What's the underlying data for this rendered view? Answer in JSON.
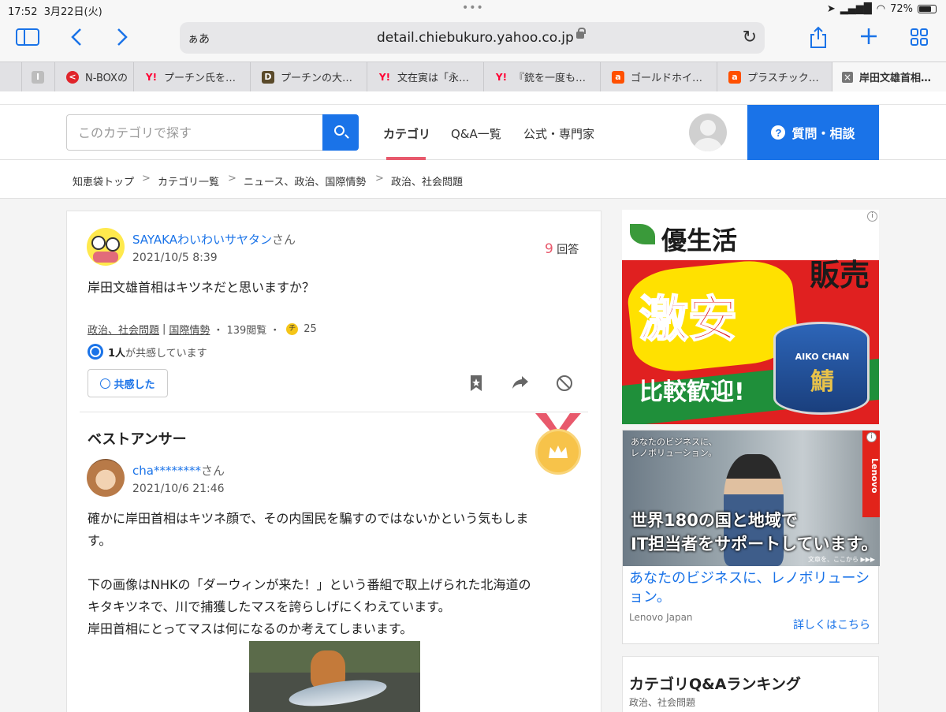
{
  "status_bar": {
    "time": "17:52",
    "date": "3月22日(火)",
    "battery": "72%"
  },
  "browser": {
    "aa_label": "ぁあ",
    "url": "detail.chiebukuro.yahoo.co.jp",
    "tabs": [
      {
        "label": "",
        "favicon": "I",
        "color": "#bdbdbd"
      },
      {
        "label": "N-BOXの",
        "favicon": "<",
        "color": "#e0242b"
      },
      {
        "label": "プーチン氏を…",
        "favicon": "Y!",
        "color": "#ff0033"
      },
      {
        "label": "プーチンの大…",
        "favicon": "D",
        "color": "#5a4a2a"
      },
      {
        "label": "文在寅は「永…",
        "favicon": "Y!",
        "color": "#ff0033"
      },
      {
        "label": "『銃を一度も…",
        "favicon": "Y!",
        "color": "#ff0033"
      },
      {
        "label": "ゴールドホイ…",
        "favicon": "a",
        "color": "#ff5000"
      },
      {
        "label": "プラスチック…",
        "favicon": "a",
        "color": "#ff5000"
      },
      {
        "label": "岸田文雄首相…",
        "favicon": "×",
        "color": "#777777"
      }
    ]
  },
  "header": {
    "search_placeholder": "このカテゴリで探す",
    "nav": [
      "カテゴリ",
      "Q&A一覧",
      "公式・専門家"
    ],
    "ask_button": "質問・相談",
    "accent": "#1a73e8",
    "underline_color": "#e8596c"
  },
  "breadcrumb": [
    "知恵袋トップ",
    "カテゴリ一覧",
    "ニュース、政治、国際情勢",
    "政治、社会問題"
  ],
  "question": {
    "user": "SAYAKAわいわいサヤタン",
    "user_suffix": "さん",
    "date": "2021/10/5 8:39",
    "answer_count": "9",
    "answer_count_suffix": "回答",
    "text": "岸田文雄首相はキツネだと思いますか？",
    "category1": "政治、社会問題",
    "category2": "国際情勢",
    "views": "139閲覧",
    "coin_label": "チ",
    "coins": "25",
    "empathy_count": "1人",
    "empathy_text": "が共感しています",
    "empathy_button": "共感した"
  },
  "best_answer": {
    "heading": "ベストアンサー",
    "user": "cha********",
    "user_suffix": "さん",
    "date": "2021/10/6 21:46",
    "p1a": "確かに岸田首相はキツネ顔で、その内国民を騙すのではないかという気もしま",
    "p1b": "す。",
    "p2a": "下の画像はNHKの「ダーウィンが来た！」という番組で取上げられた北海道の",
    "p2b": "キタキツネで、川で捕獲したマスを誇らしげにくわえています。",
    "p2c": "岸田首相にとってマスは何になるのか考えてしまいます。"
  },
  "ads": {
    "ad1": {
      "brand": "優生活",
      "big": "激安",
      "hanbai": "販売",
      "welcome": "比較歓迎!",
      "can_label": "AIKO CHAN",
      "fish": "鯖"
    },
    "ad2": {
      "small1": "あなたのビジネスに、",
      "small2": "レノボリューション。",
      "brand": "Lenovo",
      "head1": "世界180の国と地域で",
      "head2": "IT担当者をサポートしています。",
      "cta": "文章を、ここから ▶▶▶",
      "title": "あなたのビジネスに、レノボリューション。",
      "sponsor": "Lenovo Japan",
      "more": "詳しくはこちら"
    }
  },
  "ranking": {
    "title": "カテゴリQ&Aランキング",
    "sub": "政治、社会問題"
  }
}
